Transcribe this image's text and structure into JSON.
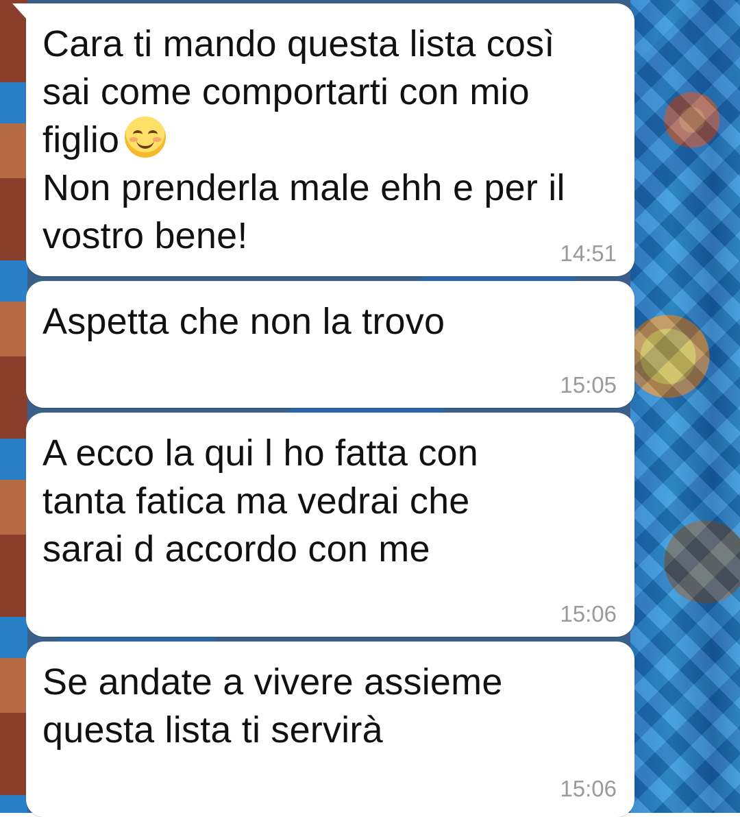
{
  "messages": [
    {
      "text_part1": "Cara ti mando questa lista così\nsai come comportarti con mio\nfiglio",
      "emoji": "smiling-face-with-smiling-eyes",
      "text_part2": "Non prenderla male ehh e per il\nvostro bene!",
      "time": "14:51"
    },
    {
      "text": "Aspetta che non la trovo",
      "time": "15:05"
    },
    {
      "text": "A ecco la qui l ho fatta con\ntanta fatica ma vedrai che\nsarai d accordo con me",
      "time": "15:06"
    },
    {
      "text": "Se andate a vivere assieme\nquesta lista ti servirà",
      "time": "15:06"
    }
  ],
  "colors": {
    "bubble_bg": "#ffffff",
    "text": "#111111",
    "timestamp": "#9a9a9a"
  }
}
